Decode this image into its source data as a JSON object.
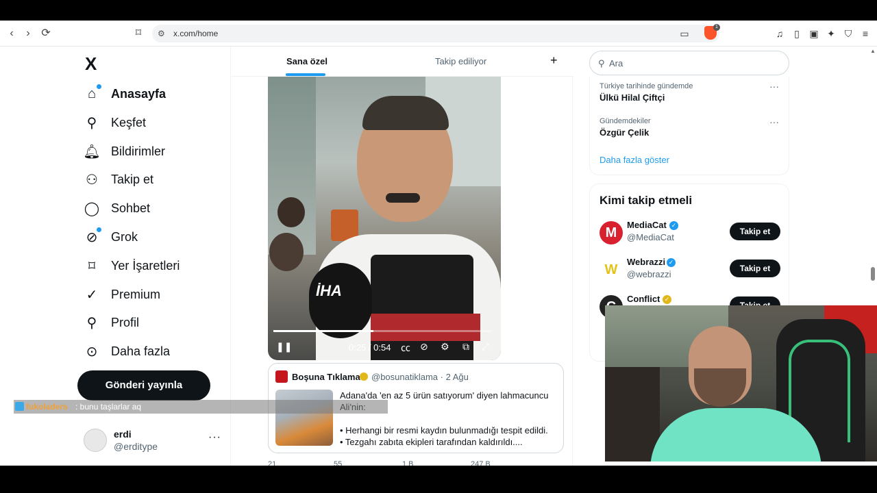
{
  "browser": {
    "url": "x.com/home",
    "brave_badge": "1"
  },
  "sidebar": {
    "logo": "X",
    "items": [
      {
        "label": "Anasayfa",
        "icon": "home-icon"
      },
      {
        "label": "Keşfet",
        "icon": "search-icon"
      },
      {
        "label": "Bildirimler",
        "icon": "bell-icon"
      },
      {
        "label": "Takip et",
        "icon": "follow-icon"
      },
      {
        "label": "Sohbet",
        "icon": "chat-icon"
      },
      {
        "label": "Grok",
        "icon": "grok-icon"
      },
      {
        "label": "Yer İşaretleri",
        "icon": "bookmark-icon"
      },
      {
        "label": "Premium",
        "icon": "premium-icon"
      },
      {
        "label": "Profil",
        "icon": "profile-icon"
      },
      {
        "label": "Daha fazla",
        "icon": "more-icon"
      }
    ],
    "post_button": "Gönderi yayınla",
    "profile": {
      "name": "erdi",
      "handle": "@erditype",
      "more": "···"
    }
  },
  "feed": {
    "tabs": [
      {
        "label": "Sana özel"
      },
      {
        "label": "Takip ediliyor"
      }
    ],
    "add_tab": "+",
    "video": {
      "time": "0:25 / 0:54",
      "progress": 0.46,
      "mic_logo": "İHA"
    },
    "quote": {
      "name": "Boşuna Tıklama",
      "handle": "@bosunatiklama · 2 Ağu",
      "text_line1": "Adana'da 'en az 5 ürün satıyorum' diyen lahmacuncu Ali'nin:",
      "text_line2": "• Herhangi bir resmi kaydın bulunmadığı tespit edildi.",
      "text_line3": "• Tezgahı zabıta ekipleri tarafından kaldırıldı...."
    },
    "actions": {
      "replies": "21",
      "reposts": "55",
      "likes": "1 B",
      "views": "247 B"
    }
  },
  "right": {
    "search_placeholder": "Ara",
    "trends": [
      {
        "category": "Türkiye tarihinde gündemde",
        "title": "Ülkü Hilal Çiftçi"
      },
      {
        "category": "Gündemdekiler",
        "title": "Özgür Çelik"
      }
    ],
    "show_more": "Daha fazla göster",
    "who_to_follow_title": "Kimi takip etmeli",
    "follow": [
      {
        "name": "MediaCat",
        "handle": "@MediaCat",
        "button": "Takip et",
        "avatar": "M",
        "color": "#d9202e"
      },
      {
        "name": "Webrazzi",
        "handle": "@webrazzi",
        "button": "Takip et",
        "avatar": "W",
        "color": "#e4c21a"
      },
      {
        "name": "Conflict",
        "handle": "",
        "button": "Takip et",
        "avatar": "C",
        "color": "#222222"
      }
    ]
  },
  "chat": {
    "user": "fukoladers",
    "message": ": bunu taşlarlar aq"
  }
}
